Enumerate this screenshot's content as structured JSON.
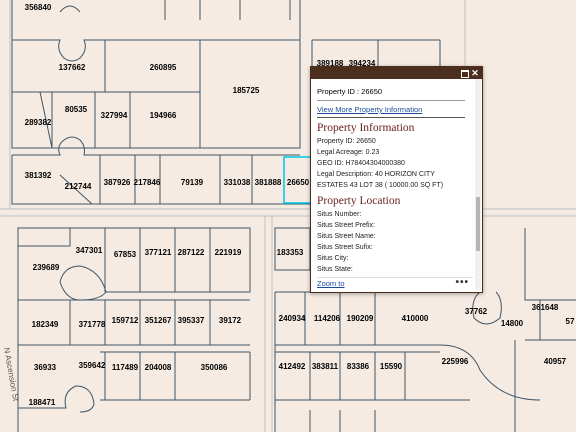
{
  "map": {
    "parcels_top": [
      "356840",
      "137662",
      "260895",
      "185725",
      "80535",
      "289382",
      "327994",
      "194966",
      "389188",
      "394234"
    ],
    "parcels_row1": [
      "381392",
      "212744",
      "387926",
      "217846",
      "79139",
      "331038",
      "381888",
      "26650"
    ],
    "parcels_mid": [
      "347301",
      "239689",
      "67853",
      "377121",
      "287122",
      "221919",
      "183353"
    ],
    "parcels_row2": [
      "182349",
      "371778",
      "159712",
      "351267",
      "395337",
      "39172",
      "240934",
      "114206",
      "190209",
      "410000",
      "37762",
      "14800",
      "361648",
      "57"
    ],
    "parcels_row3": [
      "36933",
      "359642",
      "117489",
      "204008",
      "350086",
      "412492",
      "383811",
      "83386",
      "15590",
      "225996",
      "40957"
    ],
    "parcels_bottom": [
      "188471"
    ],
    "street_label": "N Ascension St"
  },
  "popup": {
    "title": "Property ID : 26650",
    "view_more_link": "View More Property Information",
    "section1_heading": "Property Information",
    "property_id_line": "Property ID: 26650",
    "legal_acreage_line": "Legal Acreage: 0.23",
    "geo_id_line": "GEO ID: H78404304000380",
    "legal_desc_line": "Legal Description: 40 HORIZON CITY ESTATES 43 LOT 38 ( 10000.00 SQ FT)",
    "section2_heading": "Property Location",
    "situs_number": "Situs Number:",
    "situs_prefix": "Situs Street Prefix:",
    "situs_street_name": "Situs Street Name:",
    "situs_suffix": "Situs Street Sufix:",
    "situs_city": "Situs City:",
    "situs_state": "Situs State:",
    "zoom_link": "Zoom to",
    "more_menu": "•••"
  },
  "colors": {
    "map_background": "#f5ebe3",
    "parcel_line": "#3e5566",
    "street_line": "#a9b0b5",
    "highlight": "#00c8e6",
    "popup_titlebar": "#4b2e1e",
    "heading": "#6b1e1e",
    "link": "#1a4c9c"
  }
}
